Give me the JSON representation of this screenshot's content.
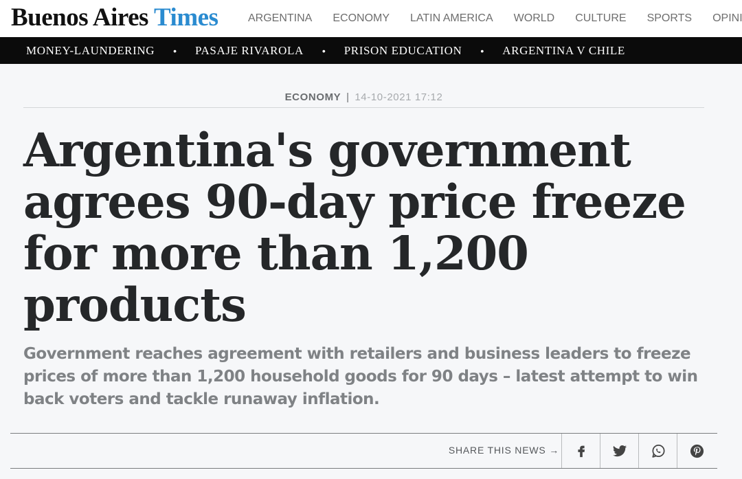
{
  "logo": {
    "part1": "Buenos Aires",
    "part2": "Times"
  },
  "main_nav": [
    "ARGENTINA",
    "ECONOMY",
    "LATIN AMERICA",
    "WORLD",
    "CULTURE",
    "SPORTS",
    "OPINION"
  ],
  "secondary_nav": [
    "MONEY-LAUNDERING",
    "PASAJE RIVAROLA",
    "PRISON EDUCATION",
    "ARGENTINA V CHILE"
  ],
  "article": {
    "category": "ECONOMY",
    "separator": "|",
    "date": "14-10-2021 17:12",
    "headline": "Argentina's government agrees 90-day price freeze for more than 1,200 products",
    "subhead": "Government reaches agreement with retailers and business leaders to freeze prices of more than 1,200 household goods for 90 days – latest attempt to win back voters and tackle runaway inflation."
  },
  "share": {
    "label": "SHARE THIS NEWS →",
    "buttons": [
      "facebook-icon",
      "twitter-icon",
      "whatsapp-icon",
      "pinterest-icon"
    ]
  },
  "colors": {
    "brand_blue": "#2a8bd0",
    "secondary_nav_bg": "#0b0b0b",
    "headline": "#252729",
    "subhead": "#7f8285"
  }
}
